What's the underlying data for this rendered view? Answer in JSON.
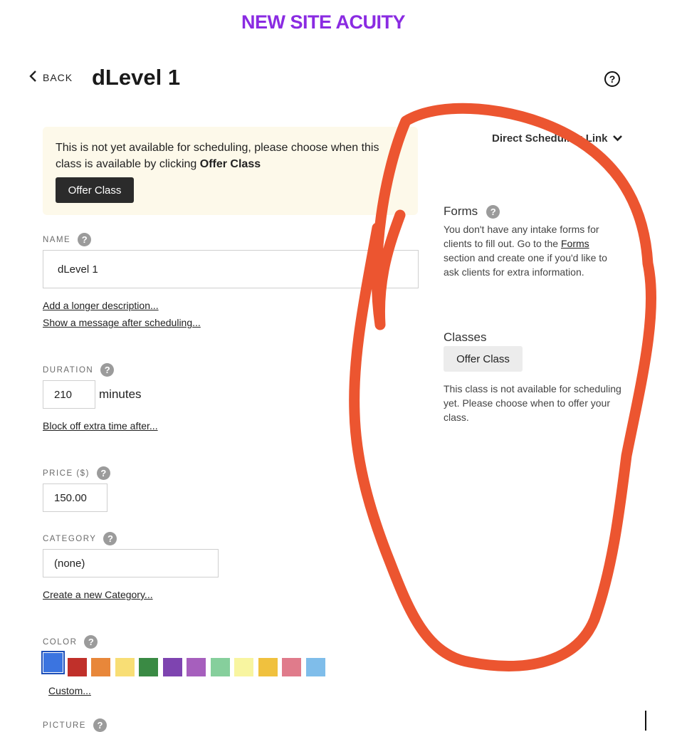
{
  "banner": {
    "title": "NEW SITE ACUITY"
  },
  "header": {
    "back_label": "BACK",
    "title": "dLevel 1",
    "help_symbol": "?"
  },
  "notice": {
    "text_before": "This is not yet available for scheduling, please choose when this class is available by clicking ",
    "text_bold": "Offer Class",
    "button_label": "Offer Class"
  },
  "fields": {
    "name": {
      "label": "NAME",
      "value": "dLevel 1"
    },
    "description_link": "Add a longer description...",
    "message_link": "Show a message after scheduling...",
    "duration": {
      "label": "DURATION",
      "value": "210",
      "unit": "minutes"
    },
    "block_off_link": "Block off extra time after...",
    "price": {
      "label": "PRICE ($)",
      "value": "150.00"
    },
    "category": {
      "label": "CATEGORY",
      "value": "(none)"
    },
    "new_category_link": "Create a new Category...",
    "color": {
      "label": "COLOR",
      "swatches": [
        "#3b74e0",
        "#c0302a",
        "#e8873a",
        "#f8de75",
        "#3a8a44",
        "#7e44b0",
        "#a65fbd",
        "#86cf9c",
        "#f8f5a0",
        "#f0c13e",
        "#e07b8b",
        "#7fbdea"
      ],
      "selected": "#3b74e0"
    },
    "custom_link": "Custom...",
    "picture": {
      "label": "PICTURE"
    }
  },
  "sidebar": {
    "direct_link_label": "Direct Scheduling Link",
    "forms": {
      "heading": "Forms",
      "text_before": "You don't have any intake forms for clients to fill out. Go to the ",
      "link": "Forms",
      "text_after": " section and create one if you'd like to ask clients for extra information."
    },
    "classes": {
      "heading": "Classes",
      "button_label": "Offer Class",
      "text": "This class is not available for scheduling yet. Please choose when to offer your class."
    }
  },
  "annotation": {
    "color": "#ec5530"
  }
}
